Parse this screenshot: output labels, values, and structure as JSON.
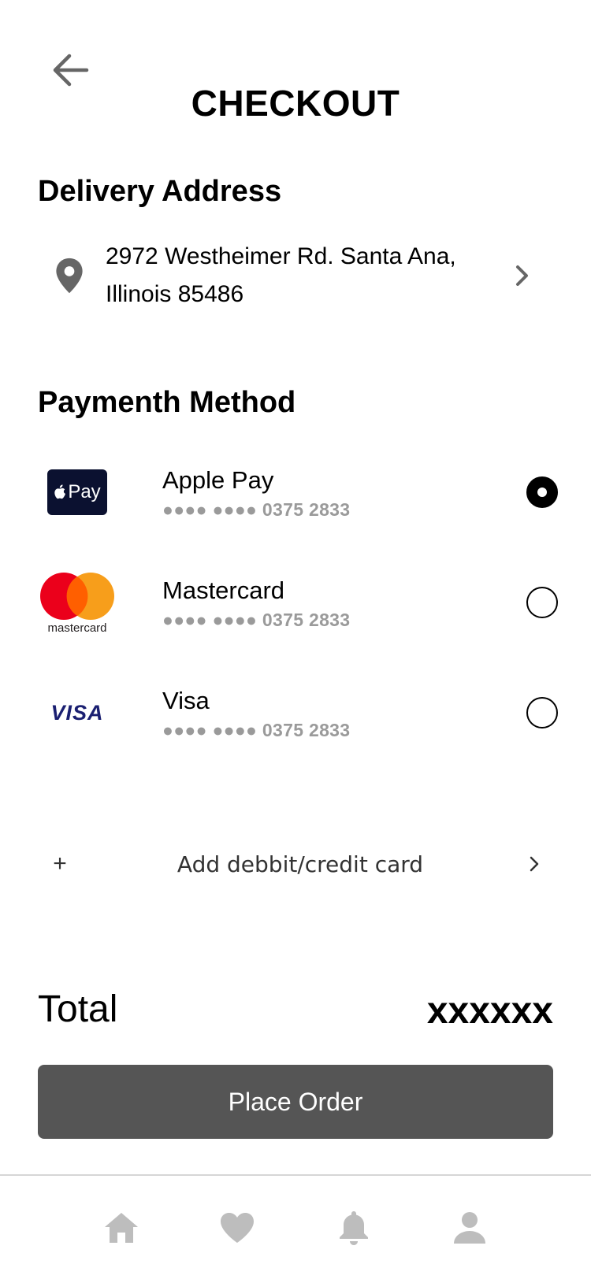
{
  "header": {
    "title": "CHECKOUT"
  },
  "delivery": {
    "section_title": "Delivery Address",
    "address_line1": "2972 Westheimer Rd. Santa Ana,",
    "address_line2": "Illinois 85486"
  },
  "payment": {
    "section_title": "Paymenth Method",
    "methods": [
      {
        "name": "Apple Pay",
        "number": "●●●● ●●●● 0375 2833",
        "logo_text": "Pay",
        "selected": true
      },
      {
        "name": "Mastercard",
        "number": "●●●● ●●●● 0375 2833",
        "logo_text": "mastercard",
        "selected": false
      },
      {
        "name": "Visa",
        "number": "●●●● ●●●● 0375 2833",
        "logo_text": "VISA",
        "selected": false
      }
    ],
    "add_card_label": "Add debbit/credit card",
    "add_icon": "+"
  },
  "total": {
    "label": "Total",
    "value": "xxxxxx"
  },
  "place_order_label": "Place Order",
  "colors": {
    "button_bg": "#555555",
    "icon_gray": "#666666",
    "nav_icon": "#bdbdbd",
    "applepay_bg": "#0b1130",
    "mastercard_red": "#eb001b",
    "mastercard_orange": "#f79e1b",
    "visa_blue": "#1a1f71"
  },
  "nav": {
    "icons": [
      "home-icon",
      "heart-icon",
      "bell-icon",
      "user-icon"
    ]
  }
}
